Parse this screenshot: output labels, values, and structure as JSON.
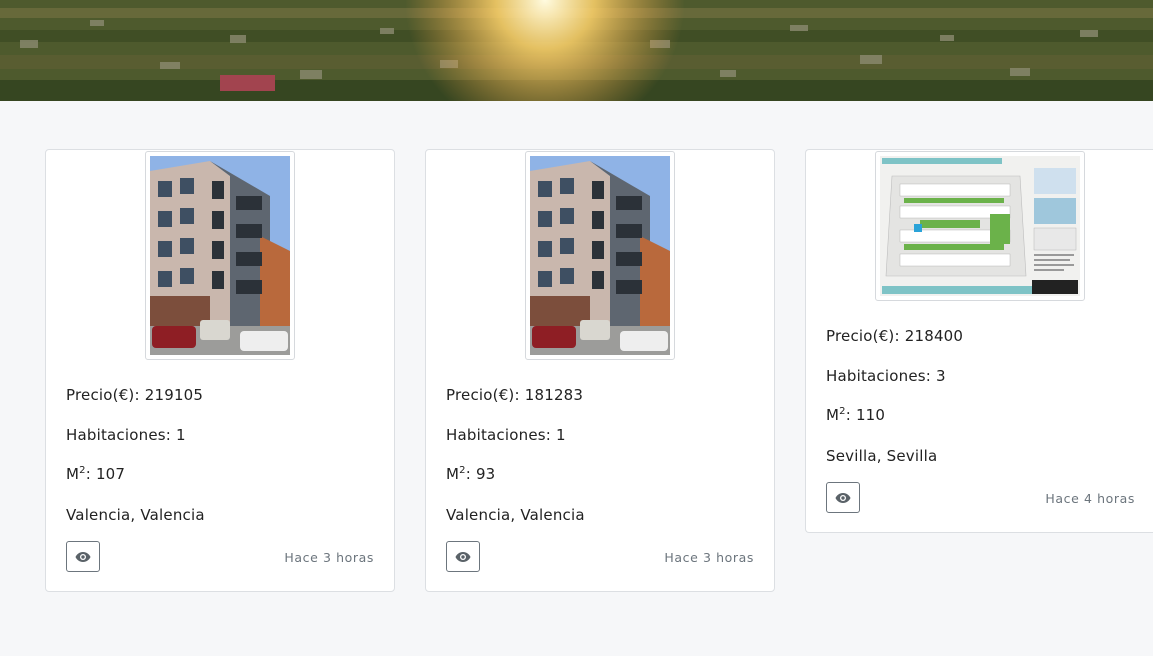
{
  "listings": [
    {
      "price_label": "Precio(€): 219105",
      "rooms_label": "Habitaciones: 1",
      "area_label": "M",
      "area_value": ": 107",
      "area_sup": "2",
      "location": "Valencia, Valencia",
      "time": "Hace 3 horas",
      "icon": "eye-icon"
    },
    {
      "price_label": "Precio(€): 181283",
      "rooms_label": "Habitaciones: 1",
      "area_label": "M",
      "area_value": ": 93",
      "area_sup": "2",
      "location": "Valencia, Valencia",
      "time": "Hace 3 horas",
      "icon": "eye-icon"
    },
    {
      "price_label": "Precio(€): 218400",
      "rooms_label": "Habitaciones: 3",
      "area_label": "M",
      "area_value": ": 110",
      "area_sup": "2",
      "location": "Sevilla, Sevilla",
      "time": "Hace 4 horas",
      "icon": "eye-icon"
    }
  ]
}
